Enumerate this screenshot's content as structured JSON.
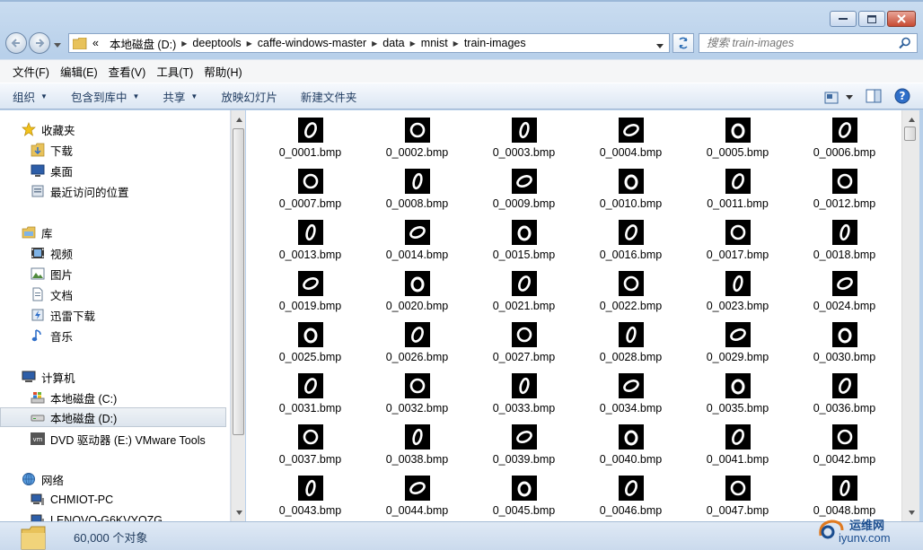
{
  "address": {
    "prefix": "«",
    "crumbs": [
      "本地磁盘 (D:)",
      "deeptools",
      "caffe-windows-master",
      "data",
      "mnist",
      "train-images"
    ]
  },
  "search": {
    "placeholder": "搜索 train-images"
  },
  "menu": [
    "文件(F)",
    "编辑(E)",
    "查看(V)",
    "工具(T)",
    "帮助(H)"
  ],
  "toolbar": {
    "organize": "组织",
    "include_in_library": "包含到库中",
    "share": "共享",
    "slideshow": "放映幻灯片",
    "new_folder": "新建文件夹"
  },
  "nav": {
    "favorites": "收藏夹",
    "downloads": "下载",
    "desktop": "桌面",
    "recent": "最近访问的位置",
    "libraries": "库",
    "videos": "视频",
    "pictures": "图片",
    "documents": "文档",
    "thunder": "迅雷下载",
    "music": "音乐",
    "computer": "计算机",
    "drive_c": "本地磁盘 (C:)",
    "drive_d": "本地磁盘 (D:)",
    "dvd": "DVD 驱动器 (E:) VMware Tools",
    "network": "网络",
    "pc1": "CHMIOT-PC",
    "pc2": "LENOVO-G6KVYOZG"
  },
  "files": [
    "0_0001.bmp",
    "0_0002.bmp",
    "0_0003.bmp",
    "0_0004.bmp",
    "0_0005.bmp",
    "0_0006.bmp",
    "0_0007.bmp",
    "0_0008.bmp",
    "0_0009.bmp",
    "0_0010.bmp",
    "0_0011.bmp",
    "0_0012.bmp",
    "0_0013.bmp",
    "0_0014.bmp",
    "0_0015.bmp",
    "0_0016.bmp",
    "0_0017.bmp",
    "0_0018.bmp",
    "0_0019.bmp",
    "0_0020.bmp",
    "0_0021.bmp",
    "0_0022.bmp",
    "0_0023.bmp",
    "0_0024.bmp",
    "0_0025.bmp",
    "0_0026.bmp",
    "0_0027.bmp",
    "0_0028.bmp",
    "0_0029.bmp",
    "0_0030.bmp",
    "0_0031.bmp",
    "0_0032.bmp",
    "0_0033.bmp",
    "0_0034.bmp",
    "0_0035.bmp",
    "0_0036.bmp",
    "0_0037.bmp",
    "0_0038.bmp",
    "0_0039.bmp",
    "0_0040.bmp",
    "0_0041.bmp",
    "0_0042.bmp",
    "0_0043.bmp",
    "0_0044.bmp",
    "0_0045.bmp",
    "0_0046.bmp",
    "0_0047.bmp",
    "0_0048.bmp"
  ],
  "status": {
    "count": "60,000 个对象"
  },
  "watermark": {
    "brand": "运维网",
    "url": "iyunv.com"
  },
  "colors": {
    "selected_bg": "#dde5ee",
    "toolbar_text": "#1e3a5f",
    "window_frame": "#b9d1ea"
  }
}
